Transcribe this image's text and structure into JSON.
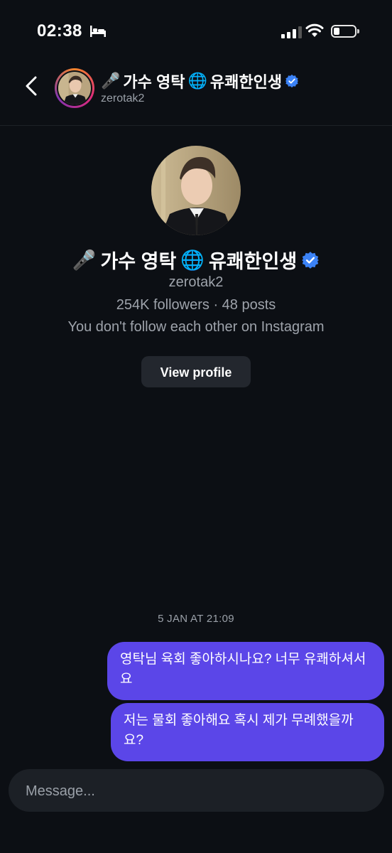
{
  "status_bar": {
    "time": "02:38",
    "icons": [
      "bed-icon",
      "signal-icon",
      "wifi-icon",
      "battery-icon"
    ]
  },
  "header": {
    "back_icon": "chevron-left-icon",
    "name_prefix_icon": "microphone-emoji",
    "name_part1": "가수 영탁",
    "name_globe_icon": "globe-emoji",
    "name_part2": "유쾌한인생",
    "verified_icon": "verified-badge-icon",
    "username": "zerotak2"
  },
  "profile": {
    "name_part1": "가수 영탁",
    "name_part2": "유쾌한인생",
    "username": "zerotak2",
    "stats": "254K followers · 48 posts",
    "follow_note": "You don't follow each other on Instagram",
    "view_profile_label": "View profile"
  },
  "conversation": {
    "timestamp": "5 JAN AT 21:09",
    "messages": [
      {
        "text": "영탁님 육회 좋아하시나요? 너무 유쾌하셔서요",
        "from": "me"
      },
      {
        "text": "저는 물회 좋아해요 혹시 제가 무례했을까요?",
        "from": "me"
      }
    ]
  },
  "composer": {
    "placeholder": "Message..."
  },
  "colors": {
    "background": "#0c0f14",
    "bubble": "#5b46e8",
    "verified": "#3b82f6",
    "secondary_text": "#9ea3ab"
  }
}
